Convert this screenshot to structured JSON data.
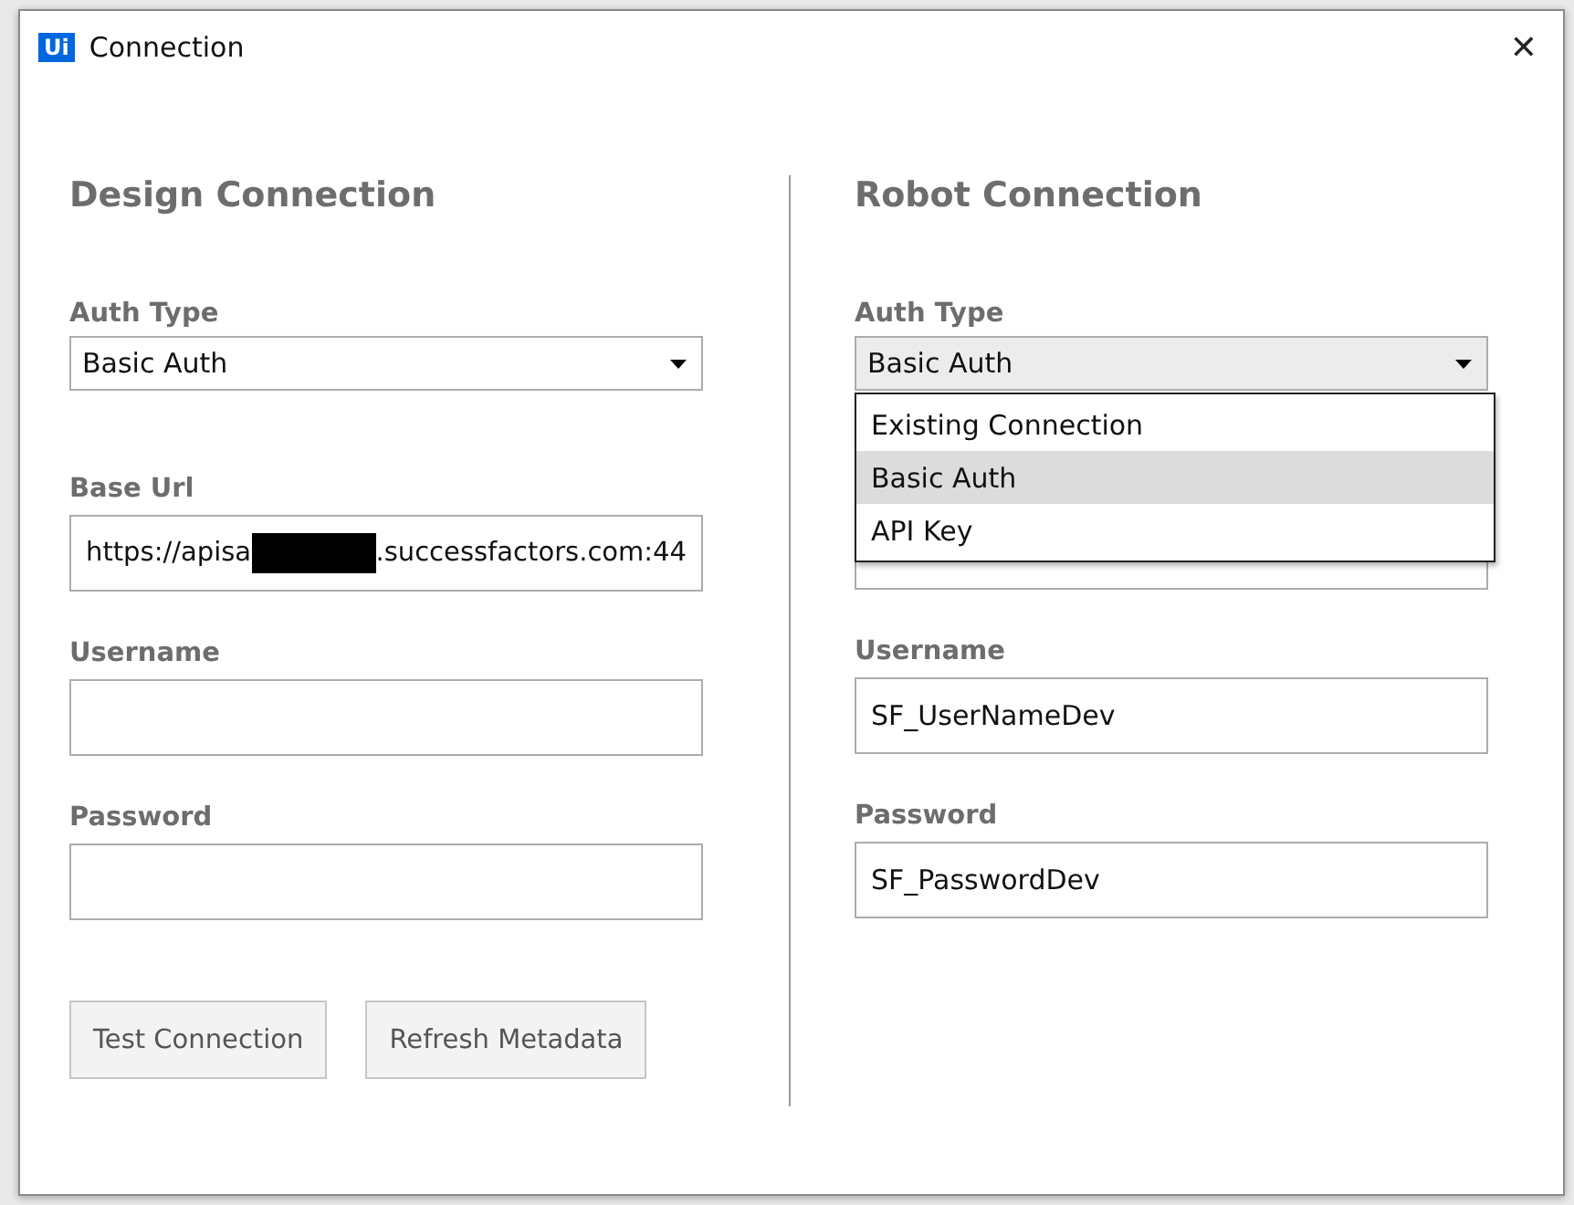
{
  "window": {
    "title": "Connection",
    "logo": "Ui",
    "close": "✕"
  },
  "design": {
    "heading": "Design Connection",
    "auth_type": {
      "label": "Auth Type",
      "value": "Basic Auth"
    },
    "base_url": {
      "label": "Base Url",
      "value_start": "https://apisa",
      "value_end": ".successfactors.com:44"
    },
    "username": {
      "label": "Username"
    },
    "password": {
      "label": "Password"
    },
    "buttons": [
      {
        "label": "Test Connection",
        "disabled": true
      },
      {
        "label": "Refresh Metadata",
        "disabled": true
      }
    ]
  },
  "robot": {
    "heading": "Robot Connection",
    "auth_type": {
      "label": "Auth Type",
      "value": "Basic Auth",
      "expanded": true,
      "options": [
        {
          "label": "Existing Connection",
          "selected": false
        },
        {
          "label": "Basic Auth",
          "selected": true
        },
        {
          "label": "API Key",
          "selected": false
        }
      ]
    },
    "username": {
      "label": "Username",
      "value": "SF_UserNameDev"
    },
    "password": {
      "label": "Password",
      "value": "SF_PasswordDev"
    }
  }
}
